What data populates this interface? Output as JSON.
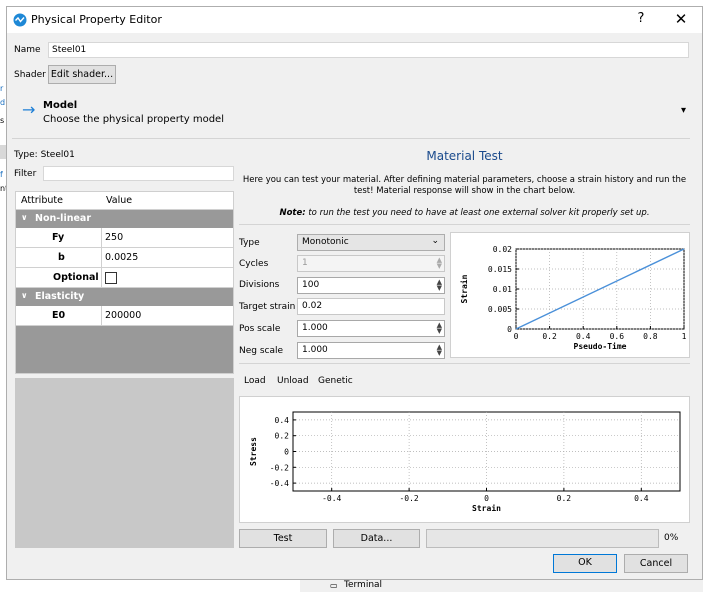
{
  "dialog": {
    "title": "Physical Property Editor",
    "help": "?",
    "close": "✕"
  },
  "name": {
    "label": "Name",
    "value": "Steel01"
  },
  "shader": {
    "label": "Shader",
    "button": "Edit shader..."
  },
  "model": {
    "title": "Model",
    "subtitle": "Choose the physical property model",
    "dropdown": "▾"
  },
  "left": {
    "type_label": "Type: Steel01",
    "filter_label": "Filter",
    "filter_value": "",
    "columns": [
      "Attribute",
      "Value"
    ],
    "groups": [
      {
        "name": "Non-linear",
        "rows": [
          {
            "attr": "Fy",
            "value": "250"
          },
          {
            "attr": "b",
            "value": "0.0025"
          },
          {
            "attr": "Optional",
            "value": ""
          }
        ]
      },
      {
        "name": "Elasticity",
        "rows": [
          {
            "attr": "E0",
            "value": "200000"
          }
        ]
      }
    ]
  },
  "material_test": {
    "title": "Material Test",
    "desc1": "Here you can test your material. After defining material parameters, choose a strain history and run the",
    "desc2": "test! Material response will show in the chart below.",
    "note_bold": "Note:",
    "note_text": " to run the test you need to have at least one external solver kit properly set up.",
    "fields": {
      "type": {
        "label": "Type",
        "value": "Monotonic"
      },
      "cycles": {
        "label": "Cycles",
        "value": "1"
      },
      "divisions": {
        "label": "Divisions",
        "value": "100"
      },
      "target_strain": {
        "label": "Target strain",
        "value": "0.02"
      },
      "pos_scale": {
        "label": "Pos scale",
        "value": "1.000"
      },
      "neg_scale": {
        "label": "Neg scale",
        "value": "1.000"
      }
    },
    "tabs": [
      "Load",
      "Unload",
      "Genetic"
    ],
    "buttons": {
      "test": "Test",
      "data": "Data..."
    },
    "progress": {
      "value": 0,
      "text": "0%"
    }
  },
  "footer": {
    "ok": "OK",
    "cancel": "Cancel"
  },
  "background": {
    "bottom_text": "Terminal",
    "left_chars": [
      "r",
      "d",
      "s",
      "f",
      "f",
      "nt"
    ]
  },
  "chart_data": [
    {
      "type": "line",
      "title": "",
      "xlabel": "Pseudo-Time",
      "ylabel": "Strain",
      "xlim": [
        0,
        1
      ],
      "ylim": [
        0,
        0.02
      ],
      "xticks": [
        "0",
        "0.2",
        "0.4",
        "0.6",
        "0.8",
        "1"
      ],
      "yticks": [
        "0",
        "0.005",
        "0.01",
        "0.015",
        "0.02"
      ],
      "grid": true,
      "series": [
        {
          "x": [
            0,
            1
          ],
          "y": [
            0,
            0.02
          ],
          "color": "#4a90d9"
        }
      ]
    },
    {
      "type": "line",
      "title": "",
      "xlabel": "Strain",
      "ylabel": "Stress",
      "xlim": [
        -0.5,
        0.5
      ],
      "ylim": [
        -0.5,
        0.5
      ],
      "xticks": [
        "-0.4",
        "-0.2",
        "0",
        "0.2",
        "0.4"
      ],
      "yticks": [
        "0.4",
        "0.2",
        "0",
        "-0.2",
        "-0.4"
      ],
      "grid": true,
      "series": []
    }
  ]
}
